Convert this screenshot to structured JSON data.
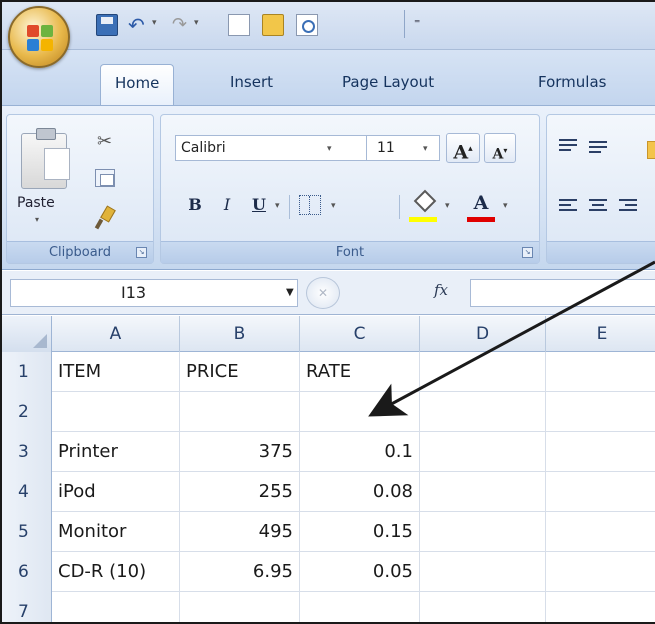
{
  "quick_access": {
    "customize_glyph": "⁼"
  },
  "tabs": [
    {
      "label": "Home"
    },
    {
      "label": "Insert"
    },
    {
      "label": "Page Layout"
    },
    {
      "label": "Formulas"
    }
  ],
  "clipboard": {
    "paste_label": "Paste",
    "group_label": "Clipboard"
  },
  "font": {
    "font_name": "Calibri",
    "font_size": "11",
    "grow_label": "A",
    "shrink_label": "A",
    "bold_label": "B",
    "italic_label": "I",
    "underline_label": "U",
    "font_color_label": "A",
    "group_label": "Font",
    "fill_color": "#ffff00",
    "font_color": "#e00000"
  },
  "formula_bar": {
    "name_box": "I13",
    "fx_label": "fx",
    "formula": ""
  },
  "sheet": {
    "columns": [
      "A",
      "B",
      "C",
      "D",
      "E"
    ],
    "rows": [
      {
        "num": "1",
        "cells": [
          "ITEM",
          "PRICE",
          "RATE",
          "",
          ""
        ]
      },
      {
        "num": "2",
        "cells": [
          "",
          "",
          "",
          "",
          ""
        ]
      },
      {
        "num": "3",
        "cells": [
          "Printer",
          "375",
          "0.1",
          "",
          ""
        ]
      },
      {
        "num": "4",
        "cells": [
          "iPod",
          "255",
          "0.08",
          "",
          ""
        ]
      },
      {
        "num": "5",
        "cells": [
          "Monitor",
          "495",
          "0.15",
          "",
          ""
        ]
      },
      {
        "num": "6",
        "cells": [
          "CD-R (10)",
          "6.95",
          "0.05",
          "",
          ""
        ]
      },
      {
        "num": "7",
        "cells": [
          "",
          "",
          "",
          "",
          ""
        ]
      }
    ]
  }
}
